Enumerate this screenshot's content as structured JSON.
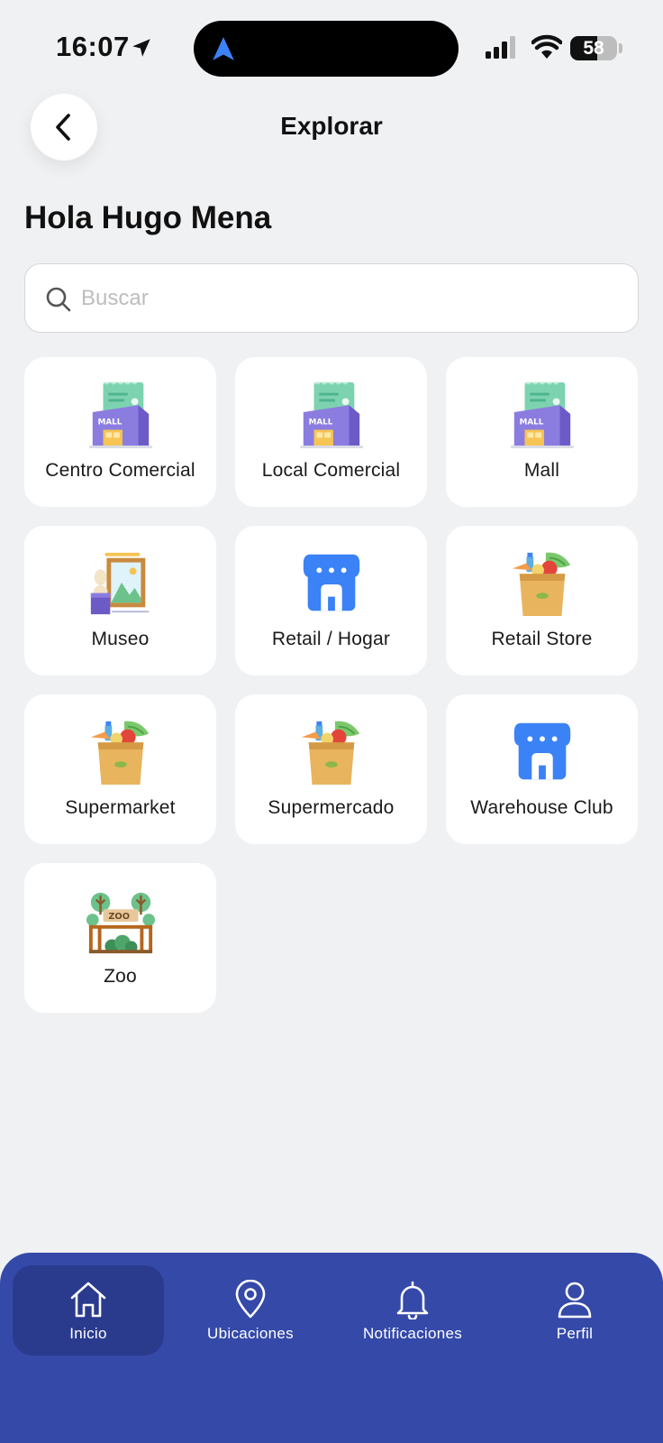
{
  "status_bar": {
    "time": "16:07",
    "battery": "58",
    "battery_level": 0.58
  },
  "header": {
    "title": "Explorar"
  },
  "greeting": "Hola Hugo Mena",
  "search": {
    "placeholder": "Buscar",
    "value": ""
  },
  "categories": [
    {
      "label": "Centro Comercial",
      "icon": "mall-icon"
    },
    {
      "label": "Local Comercial",
      "icon": "mall-icon"
    },
    {
      "label": "Mall",
      "icon": "mall-icon"
    },
    {
      "label": "Museo",
      "icon": "museum-icon"
    },
    {
      "label": "Retail / Hogar",
      "icon": "store-icon"
    },
    {
      "label": "Retail Store",
      "icon": "grocery-bag-icon"
    },
    {
      "label": "Supermarket",
      "icon": "grocery-bag-icon"
    },
    {
      "label": "Supermercado",
      "icon": "grocery-bag-icon"
    },
    {
      "label": "Warehouse Club",
      "icon": "store-icon"
    },
    {
      "label": "Zoo",
      "icon": "zoo-icon"
    }
  ],
  "bottom_nav": {
    "items": [
      {
        "label": "Inicio",
        "icon": "home-icon",
        "active": true
      },
      {
        "label": "Ubicaciones",
        "icon": "location-pin-icon",
        "active": false
      },
      {
        "label": "Notificaciones",
        "icon": "bell-icon",
        "active": false
      },
      {
        "label": "Perfil",
        "icon": "user-icon",
        "active": false
      }
    ]
  },
  "colors": {
    "background": "#F0F1F3",
    "nav_background": "#3549A8",
    "nav_active": "#2A3B8E",
    "store_blue": "#3B82F6"
  }
}
